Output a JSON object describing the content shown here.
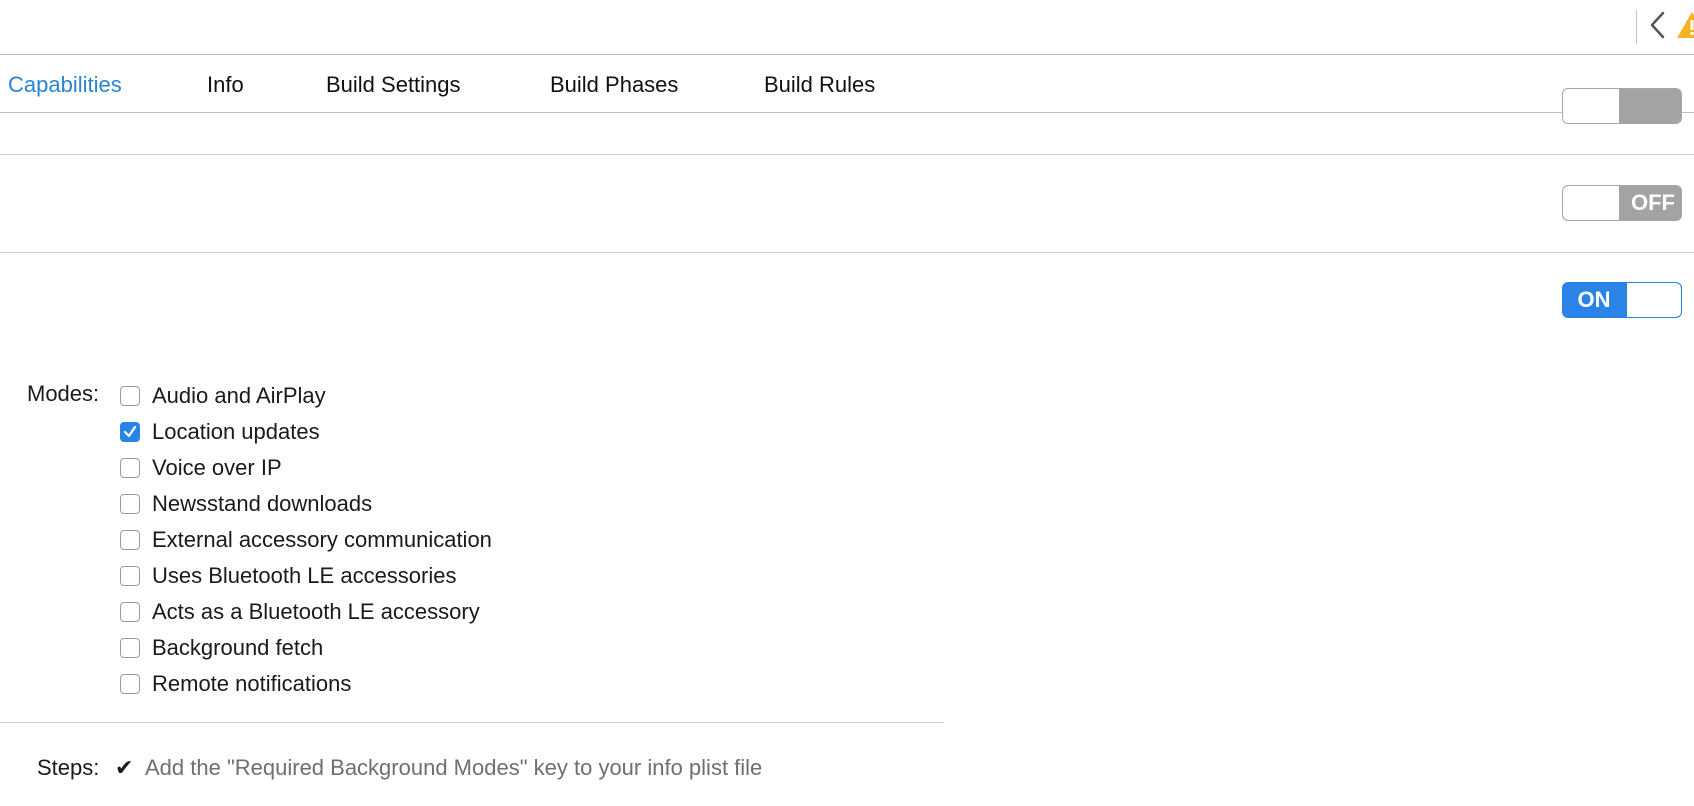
{
  "tabs": [
    {
      "label": "Capabilities",
      "active": true
    },
    {
      "label": "Info",
      "active": false
    },
    {
      "label": "Build Settings",
      "active": false
    },
    {
      "label": "Build Phases",
      "active": false
    },
    {
      "label": "Build Rules",
      "active": false
    }
  ],
  "toggles": {
    "off_label": "OFF",
    "on_label": "ON"
  },
  "background_modes": {
    "label": "Modes:",
    "items": [
      {
        "label": "Audio and AirPlay",
        "checked": false
      },
      {
        "label": "Location updates",
        "checked": true
      },
      {
        "label": "Voice over IP",
        "checked": false
      },
      {
        "label": "Newsstand downloads",
        "checked": false
      },
      {
        "label": "External accessory communication",
        "checked": false
      },
      {
        "label": "Uses Bluetooth LE accessories",
        "checked": false
      },
      {
        "label": "Acts as a Bluetooth LE accessory",
        "checked": false
      },
      {
        "label": "Background fetch",
        "checked": false
      },
      {
        "label": "Remote notifications",
        "checked": false
      }
    ]
  },
  "steps": {
    "label": "Steps:",
    "check_glyph": "✔",
    "text": "Add the \"Required Background Modes\" key to your info plist file"
  },
  "colors": {
    "accent": "#2a84e8",
    "tab_active": "#2a84d4",
    "toggle_off": "#a3a3a3",
    "warning": "#f5b324",
    "muted_text": "#6f6f6f"
  },
  "icons": {
    "back": "chevron-left-icon",
    "warning": "warning-triangle-icon",
    "checkmark": "checkmark-icon"
  }
}
